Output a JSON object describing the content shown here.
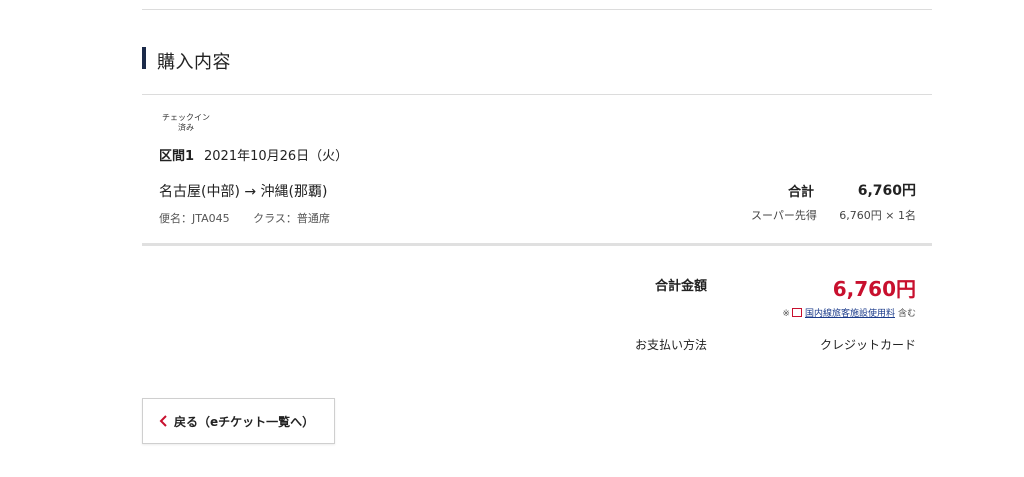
{
  "section": {
    "title": "購入内容"
  },
  "segment": {
    "checkin_status_line1": "チェックイン",
    "checkin_status_line2": "済み",
    "label": "区間1",
    "date": "2021年10月26日（火）",
    "route": "名古屋(中部) → 沖縄(那覇)",
    "flight": "便名：JTA045",
    "class": "クラス：普通席",
    "subtotal_label": "合計",
    "subtotal_value": "6,760円",
    "fare_name": "スーパー先得",
    "fare_detail": "6,760円 × 1名"
  },
  "summary": {
    "total_label": "合計金額",
    "total_value": "6,760円",
    "note_prefix": "※",
    "note_link": "国内線旅客施設使用料",
    "note_suffix": "含む",
    "payment_label": "お支払い方法",
    "payment_value": "クレジットカード"
  },
  "back_button": {
    "label": "戻る（eチケット一覧へ）"
  },
  "colors": {
    "accent": "#c8102e",
    "section_bar": "#1b2a49",
    "link": "#1a3a8a"
  },
  "icons": {
    "back": "chevron-left-icon",
    "external": "external-link-icon"
  }
}
